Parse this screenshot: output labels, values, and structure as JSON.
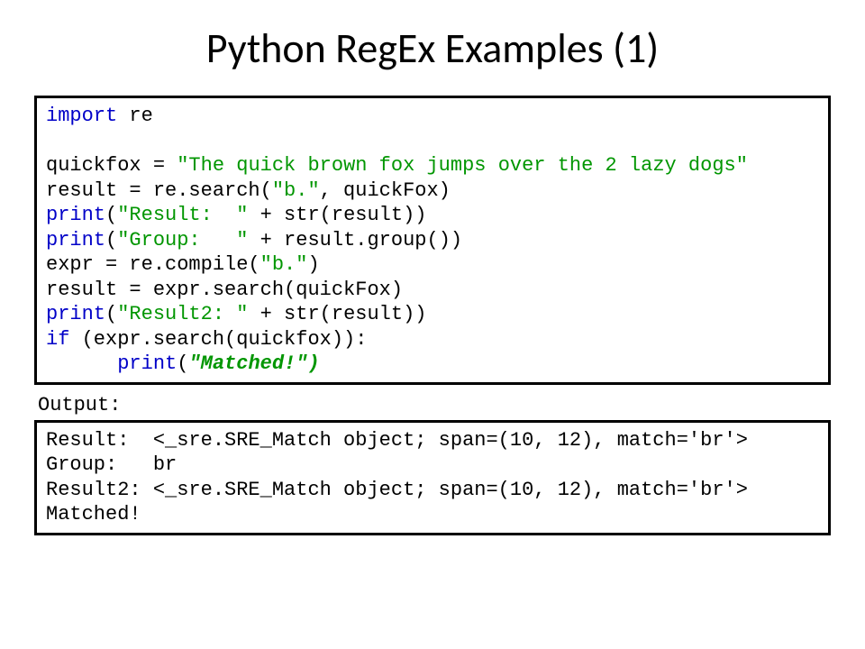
{
  "title": "Python RegEx Examples (1)",
  "code": {
    "l1a": "import",
    "l1b": " re",
    "l2a": "quickfox = ",
    "l2b": "\"The quick brown fox jumps over the 2 lazy dogs\"",
    "l3a": "result = re.search(",
    "l3b": "\"b.\"",
    "l3c": ", quickFox)",
    "l4a": "print",
    "l4b": "(",
    "l4c": "\"Result:  \"",
    "l4d": " + str(result))",
    "l5a": "print",
    "l5b": "(",
    "l5c": "\"Group:   \"",
    "l5d": " + result.group())",
    "l6a": "expr = re.compile(",
    "l6b": "\"b.\"",
    "l6c": ")",
    "l7": "result = expr.search(quickFox)",
    "l8a": "print",
    "l8b": "(",
    "l8c": "\"Result2: \"",
    "l8d": " + str(result))",
    "l9a": "if",
    "l9b": " (expr.search(quickfox)):",
    "l10a": "      print",
    "l10b": "(",
    "l10c": "\"Matched!\"",
    "l10d": ")"
  },
  "outputLabel": "Output:",
  "output": {
    "l1": "Result:  <_sre.SRE_Match object; span=(10, 12), match='br'>",
    "l2": "Group:   br",
    "l3": "Result2: <_sre.SRE_Match object; span=(10, 12), match='br'>",
    "l4": "Matched!"
  }
}
